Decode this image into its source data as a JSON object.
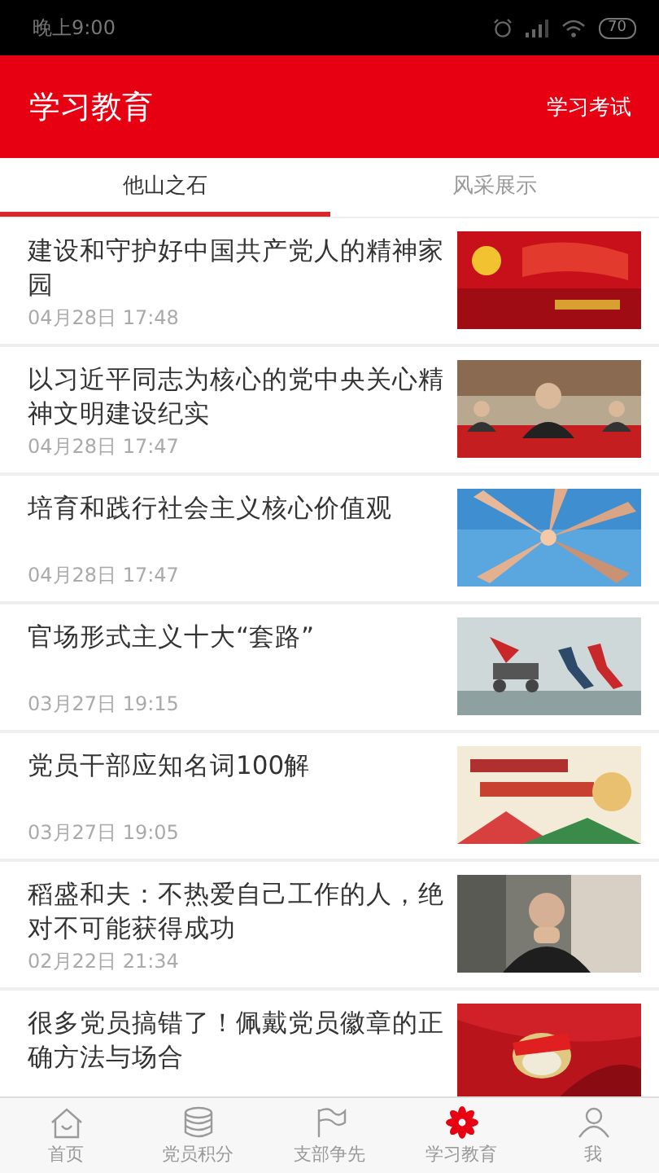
{
  "status_bar": {
    "time": "晚上9:00",
    "battery": "70"
  },
  "header": {
    "title": "学习教育",
    "action": "学习考试"
  },
  "tabs": [
    {
      "label": "他山之石",
      "selected": true
    },
    {
      "label": "风采展示",
      "selected": false
    }
  ],
  "articles": [
    {
      "title": "建设和守护好中国共产党人的精神家园",
      "date": "04月28日 17:48"
    },
    {
      "title": "以习近平同志为核心的党中央关心精神文明建设纪实",
      "date": "04月28日 17:47"
    },
    {
      "title": "培育和践行社会主义核心价值观",
      "date": "04月28日 17:47"
    },
    {
      "title": "官场形式主义十大“套路”",
      "date": "03月27日 19:15"
    },
    {
      "title": "党员干部应知名词100解",
      "date": "03月27日 19:05"
    },
    {
      "title": "稻盛和夫：不热爱自己工作的人，绝对不可能获得成功",
      "date": "02月22日 21:34"
    },
    {
      "title": "很多党员搞错了！佩戴党员徽章的正确方法与场合"
    }
  ],
  "bottom_nav": [
    {
      "label": "首页",
      "selected": false
    },
    {
      "label": "党员积分",
      "selected": false
    },
    {
      "label": "支部争先",
      "selected": false
    },
    {
      "label": "学习教育",
      "selected": true
    },
    {
      "label": "我",
      "selected": false
    }
  ]
}
